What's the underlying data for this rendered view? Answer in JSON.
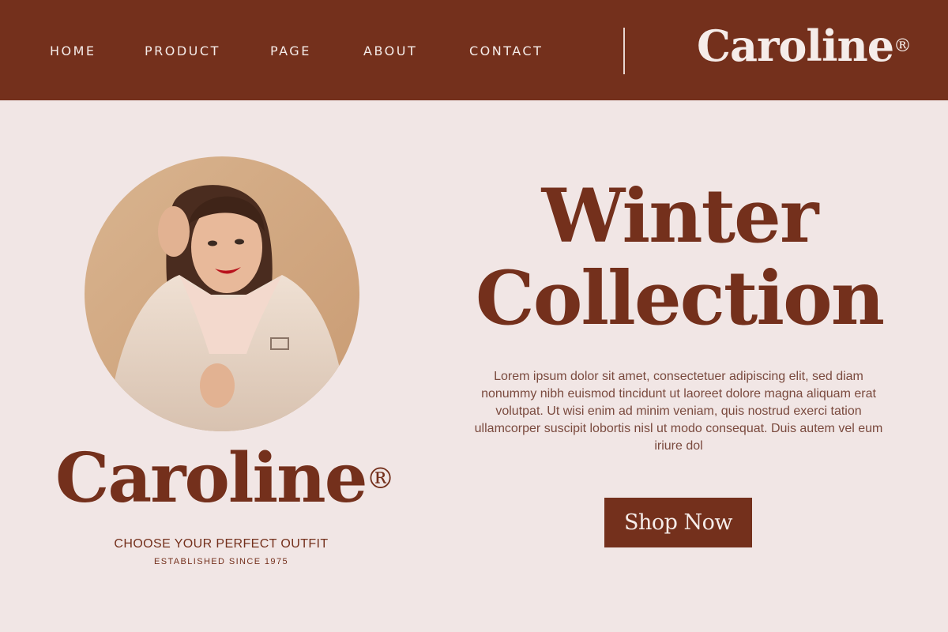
{
  "nav": {
    "items": [
      {
        "label": "HOME"
      },
      {
        "label": "PRODUCT"
      },
      {
        "label": "PAGE"
      },
      {
        "label": "ABOUT"
      },
      {
        "label": "CONTACT"
      }
    ]
  },
  "brand": {
    "name": "Caroline",
    "mark": "®"
  },
  "hero": {
    "headline_line1": "Winter",
    "headline_line2": "Collection",
    "body": "Lorem ipsum dolor sit amet, consectetuer adipiscing elit, sed diam nonummy nibh euismod tincidunt ut laoreet dolore magna aliquam erat volutpat. Ut wisi enim ad minim veniam, quis nostrud exerci tation ullamcorper suscipit lobortis nisl ut modo consequat. Duis autem vel eum iriure dol",
    "cta_label": "Shop Now"
  },
  "branding": {
    "tagline": "CHOOSE YOUR PERFECT OUTFIT",
    "established": "ESTABLISHED SINCE 1975"
  },
  "colors": {
    "primary": "#74301c",
    "background": "#f1e6e5",
    "header_text": "#f5ece9",
    "body_text": "#7a4a3e"
  }
}
